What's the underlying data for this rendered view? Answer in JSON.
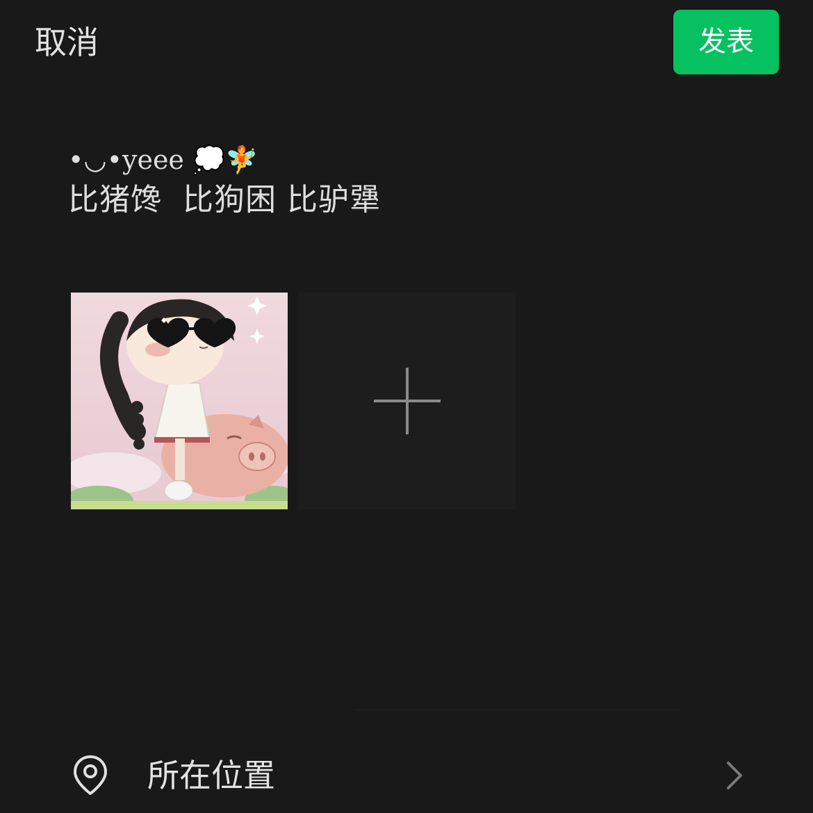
{
  "header": {
    "cancel_label": "取消",
    "publish_label": "发表",
    "publish_color": "#06c160"
  },
  "post": {
    "text_line1": "•◡•yeee 💭🧚",
    "text_line2": "比猪馋  比狗困 比驴犟"
  },
  "media": {
    "image_subject": "cartoon girl with heart sunglasses riding a pink pig",
    "add_icon": "plus-icon"
  },
  "location": {
    "label": "所在位置",
    "icon": "location-pin-icon",
    "chevron_icon": "chevron-right-icon"
  }
}
